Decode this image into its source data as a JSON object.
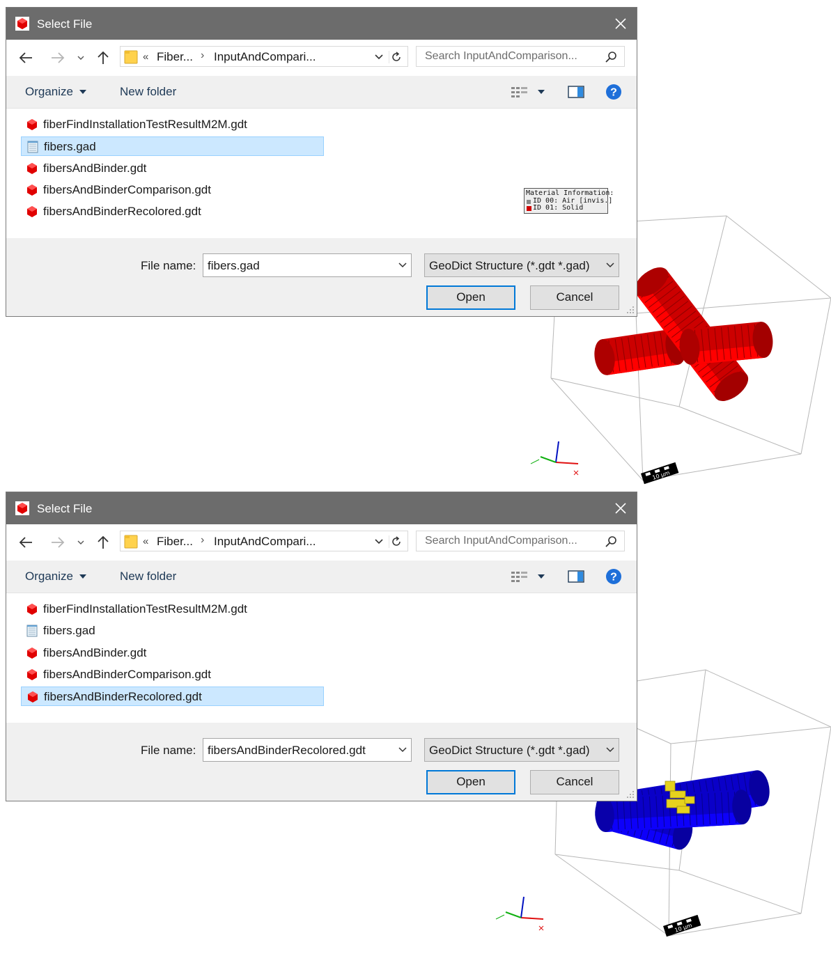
{
  "panels": [
    {
      "title": "Select File",
      "breadcrumb": {
        "sep1": "«",
        "crumb1": "Fiber...",
        "sep2": "›",
        "crumb2": "InputAndCompari..."
      },
      "search_placeholder": "Search InputAndComparison...",
      "toolbar": {
        "organize": "Organize",
        "new_folder": "New folder"
      },
      "files": [
        {
          "name": "fiberFindInstallationTestResultM2M.gdt",
          "icon": "geodict-structure-icon",
          "selected": false
        },
        {
          "name": "fibers.gad",
          "icon": "notepad-file-icon",
          "selected": true
        },
        {
          "name": "fibersAndBinder.gdt",
          "icon": "geodict-structure-icon",
          "selected": false
        },
        {
          "name": "fibersAndBinderComparison.gdt",
          "icon": "geodict-structure-icon",
          "selected": false
        },
        {
          "name": "fibersAndBinderRecolored.gdt",
          "icon": "geodict-structure-icon",
          "selected": false
        }
      ],
      "file_name_label": "File name:",
      "file_name_value": "fibers.gad",
      "file_type": "GeoDict Structure (*.gdt *.gad)",
      "open_label": "Open",
      "cancel_label": "Cancel",
      "material_info": {
        "header": "Material Information:",
        "entries": [
          "ID 00: Air [invis.]",
          "ID 01: Solid"
        ]
      },
      "scale_bar_label": "10 µm",
      "fiber_color": "#cc0000",
      "binder_color": null
    },
    {
      "title": "Select File",
      "breadcrumb": {
        "sep1": "«",
        "crumb1": "Fiber...",
        "sep2": "›",
        "crumb2": "InputAndCompari..."
      },
      "search_placeholder": "Search InputAndComparison...",
      "toolbar": {
        "organize": "Organize",
        "new_folder": "New folder"
      },
      "files": [
        {
          "name": "fiberFindInstallationTestResultM2M.gdt",
          "icon": "geodict-structure-icon",
          "selected": false
        },
        {
          "name": "fibers.gad",
          "icon": "notepad-file-icon",
          "selected": false
        },
        {
          "name": "fibersAndBinder.gdt",
          "icon": "geodict-structure-icon",
          "selected": false
        },
        {
          "name": "fibersAndBinderComparison.gdt",
          "icon": "geodict-structure-icon",
          "selected": false
        },
        {
          "name": "fibersAndBinderRecolored.gdt",
          "icon": "geodict-structure-icon",
          "selected": true
        }
      ],
      "file_name_label": "File name:",
      "file_name_value": "fibersAndBinderRecolored.gdt",
      "file_type": "GeoDict Structure (*.gdt *.gad)",
      "open_label": "Open",
      "cancel_label": "Cancel",
      "material_info": null,
      "scale_bar_label": "10 µm",
      "fiber_color": "#0a00c8",
      "binder_color": "#e6d21e"
    }
  ]
}
